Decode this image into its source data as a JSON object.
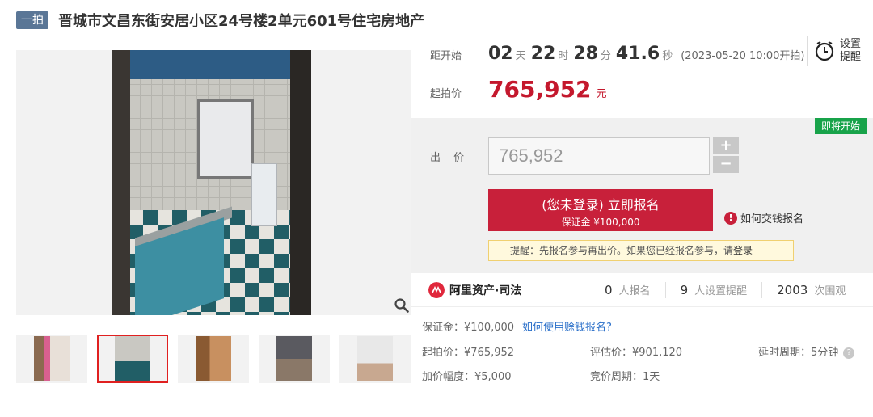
{
  "header": {
    "badge": "一拍",
    "title": "晋城市文昌东街安居小区24号楼2单元601号住宅房地产"
  },
  "countdown": {
    "label": "距开始",
    "days": "02",
    "days_unit": "天",
    "hours": "22",
    "hours_unit": "时",
    "minutes": "28",
    "minutes_unit": "分",
    "seconds": "41.6",
    "seconds_unit": "秒",
    "start_time": "(2023-05-20 10:00开拍)"
  },
  "remind": {
    "label": "设置提醒",
    "icon": "alarm-clock-icon"
  },
  "starting_price": {
    "label": "起拍价",
    "value": "765,952",
    "unit": "元"
  },
  "bid": {
    "status": "即将开始",
    "label": "出 价",
    "input_value": "765,952",
    "plus": "+",
    "minus": "−",
    "signup_main": "(您未登录) 立即报名",
    "signup_sub": "保证金 ¥100,000",
    "offline_link": "如何交钱报名",
    "notice_text": "提醒：先报名参与再出价。如果您已经报名参与，请",
    "notice_link": "登录"
  },
  "stats": {
    "platform": "阿里资产·司法",
    "registrations": "0",
    "registrations_label": "人报名",
    "reminders": "9",
    "reminders_label": "人设置提醒",
    "views": "2003",
    "views_label": "次围观"
  },
  "details": {
    "deposit": "保证金：¥100,000",
    "deposit_link": "如何使用赊钱报名?",
    "start_price": "起拍价：¥765,952",
    "appraisal": "评估价：¥901,120",
    "delay_period": "延时周期：5分钟",
    "increment": "加价幅度：¥5,000",
    "bidding_period": "竞价周期：1天"
  },
  "colors": {
    "accent_red": "#c8203a",
    "price_red": "#c4182d",
    "status_green": "#18a34a",
    "link_blue": "#2a6fc9"
  }
}
